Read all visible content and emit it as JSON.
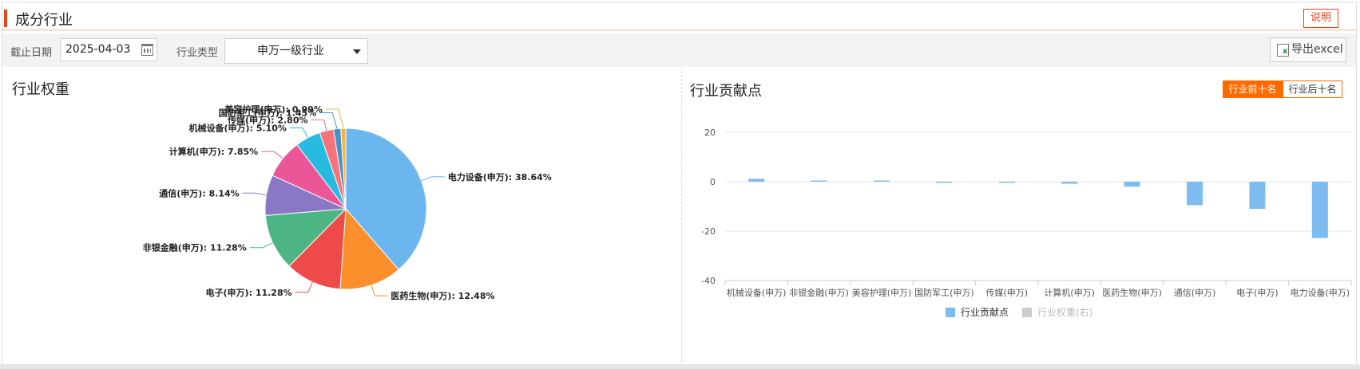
{
  "header": {
    "title": "成分行业",
    "help_label": "说明"
  },
  "toolbar": {
    "date_label": "截止日期",
    "date_value": "2025-04-03",
    "type_label": "行业类型",
    "type_value": "申万一级行业",
    "export_label": "导出excel"
  },
  "colors": {
    "accent": "#e8461b",
    "toggle_active": "#ff6a00",
    "bar": "#7cbcf0"
  },
  "pie": {
    "title": "行业权重",
    "chart_data": {
      "type": "pie",
      "slices": [
        {
          "name": "电力设备(申万)",
          "value": 38.64,
          "label": "电力设备(申万): 38.64%",
          "color": "#6cb6f0"
        },
        {
          "name": "医药生物(申万)",
          "value": 12.48,
          "label": "医药生物(申万): 12.48%",
          "color": "#fb8f2c"
        },
        {
          "name": "电子(申万)",
          "value": 11.28,
          "label": "电子(申万): 11.28%",
          "color": "#ee4a4a"
        },
        {
          "name": "非银金融(申万)",
          "value": 11.28,
          "label": "非银金融(申万): 11.28%",
          "color": "#4db583"
        },
        {
          "name": "通信(申万)",
          "value": 8.14,
          "label": "通信(申万): 8.14%",
          "color": "#8a78c4"
        },
        {
          "name": "计算机(申万)",
          "value": 7.85,
          "label": "计算机(申万): 7.85%",
          "color": "#ea5698"
        },
        {
          "name": "机械设备(申万)",
          "value": 5.1,
          "label": "机械设备(申万): 5.10%",
          "color": "#27bbdf"
        },
        {
          "name": "传媒(申万)",
          "value": 2.8,
          "label": "传媒(申万): 2.80%",
          "color": "#f8727a"
        },
        {
          "name": "国防军工(申万)",
          "value": 1.45,
          "label": "国防军工(申万): 1.45%",
          "color": "#4a90c8"
        },
        {
          "name": "美容护理(申万)",
          "value": 0.99,
          "label": "美容护理(申万): 0.99%",
          "color": "#f2b43c"
        }
      ]
    }
  },
  "bar": {
    "title": "行业贡献点",
    "toggle_top": "行业前十名",
    "toggle_bottom": "行业后十名",
    "chart_data": {
      "type": "bar",
      "categories": [
        "机械设备(申万)",
        "非银金融(申万)",
        "美容护理(申万)",
        "国防军工(申万)",
        "传媒(申万)",
        "计算机(申万)",
        "医药生物(申万)",
        "通信(申万)",
        "电子(申万)",
        "电力设备(申万)"
      ],
      "series": [
        {
          "name": "行业贡献点",
          "values": [
            1.2,
            0.3,
            0.2,
            -0.3,
            -0.4,
            -0.8,
            -2.0,
            -9.5,
            -11.0,
            -22.8
          ]
        },
        {
          "name": "行业权重(右)",
          "values": []
        }
      ],
      "yticks": [
        20,
        0,
        -20,
        -40
      ],
      "ylim": [
        -40,
        20
      ],
      "legend": "bottom"
    }
  }
}
